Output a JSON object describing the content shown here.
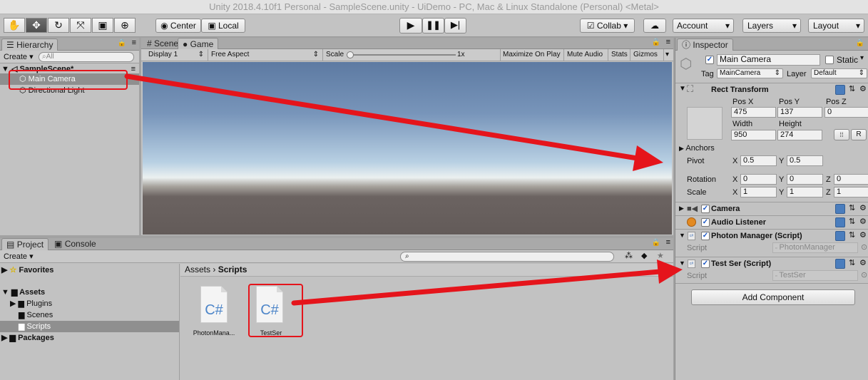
{
  "window": {
    "title": "Unity 2018.4.10f1 Personal - SampleScene.unity - UiDemo - PC, Mac & Linux Standalone (Personal) <Metal>"
  },
  "toolbar": {
    "pivot": "Center",
    "space": "Local",
    "collab": "Collab",
    "account": "Account",
    "layers": "Layers",
    "layout": "Layout"
  },
  "hierarchy": {
    "tab": "Hierarchy",
    "create": "Create",
    "search_placeholder": "All",
    "scene": "SampleScene*",
    "items": [
      "Main Camera",
      "Directional Light"
    ]
  },
  "view": {
    "tabs": [
      "Scene",
      "Game"
    ],
    "display": "Display 1",
    "aspect": "Free Aspect",
    "scale_label": "Scale",
    "scale_value": "1x",
    "buttons": [
      "Maximize On Play",
      "Mute Audio",
      "Stats",
      "Gizmos"
    ]
  },
  "project": {
    "tabs": [
      "Project",
      "Console"
    ],
    "create": "Create",
    "favorites": "Favorites",
    "assets": "Assets",
    "asset_children": [
      "Plugins",
      "Scenes",
      "Scripts"
    ],
    "packages": "Packages",
    "breadcrumb": [
      "Assets",
      "Scripts"
    ],
    "files": [
      {
        "name": "PhotonMana...",
        "icon": "C#"
      },
      {
        "name": "TestSer",
        "icon": "C#"
      }
    ]
  },
  "inspector": {
    "tab": "Inspector",
    "object_name": "Main Camera",
    "static_label": "Static",
    "tag_label": "Tag",
    "tag_value": "MainCamera",
    "layer_label": "Layer",
    "layer_value": "Default",
    "rect": {
      "title": "Rect Transform",
      "pos_x_label": "Pos X",
      "pos_y_label": "Pos Y",
      "pos_z_label": "Pos Z",
      "pos_x": "475",
      "pos_y": "137",
      "pos_z": "0",
      "width_label": "Width",
      "height_label": "Height",
      "width": "950",
      "height": "274",
      "r_button": "R",
      "anchors": "Anchors",
      "pivot_label": "Pivot",
      "pivot_x": "0.5",
      "pivot_y": "0.5",
      "rotation_label": "Rotation",
      "rot_x": "0",
      "rot_y": "0",
      "rot_z": "0",
      "scale_label": "Scale",
      "scale_x": "1",
      "scale_y": "1",
      "scale_z": "1",
      "x": "X",
      "y": "Y",
      "z": "Z"
    },
    "components": {
      "camera": "Camera",
      "audio": "Audio Listener",
      "photon": "Photon Manager (Script)",
      "testser": "Test Ser (Script)",
      "script_label": "Script",
      "photon_script": "PhotonManager",
      "testser_script": "TestSer"
    },
    "add_component": "Add Component"
  },
  "colors": {
    "annotation": "#e5141b",
    "selection": "#8f8f8f",
    "accent": "#3d6fb6"
  }
}
